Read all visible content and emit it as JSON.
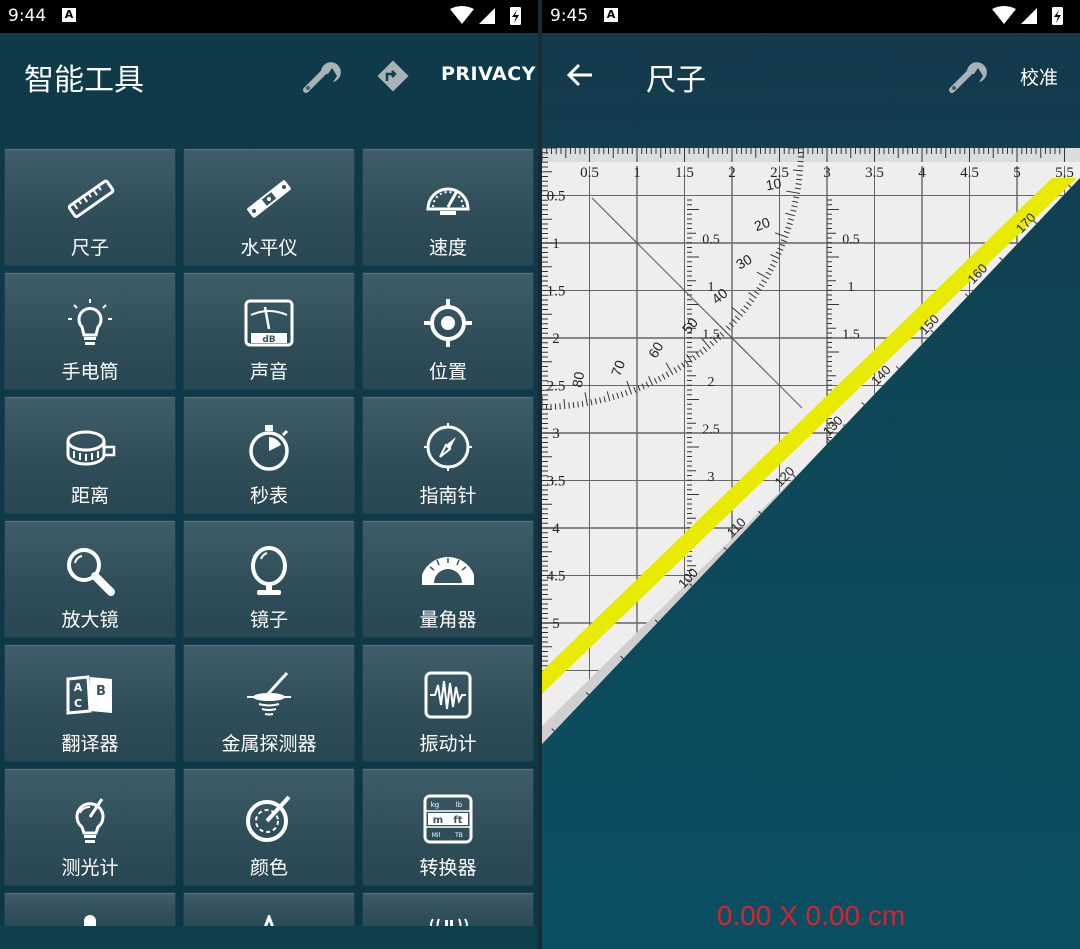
{
  "left": {
    "status_time": "9:44",
    "status_notification": "A",
    "title": "智能工具",
    "privacy_label": "PRIVACY",
    "tools": [
      {
        "label": "尺子",
        "icon": "ruler-icon"
      },
      {
        "label": "水平仪",
        "icon": "level-icon"
      },
      {
        "label": "速度",
        "icon": "speedometer-icon"
      },
      {
        "label": "手电筒",
        "icon": "flashlight-icon"
      },
      {
        "label": "声音",
        "icon": "sound-meter-icon"
      },
      {
        "label": "位置",
        "icon": "location-icon"
      },
      {
        "label": "距离",
        "icon": "tape-measure-icon"
      },
      {
        "label": "秒表",
        "icon": "stopwatch-icon"
      },
      {
        "label": "指南针",
        "icon": "compass-icon"
      },
      {
        "label": "放大镜",
        "icon": "magnifier-icon"
      },
      {
        "label": "镜子",
        "icon": "mirror-icon"
      },
      {
        "label": "量角器",
        "icon": "protractor-icon"
      },
      {
        "label": "翻译器",
        "icon": "translator-icon"
      },
      {
        "label": "金属探测器",
        "icon": "metal-detector-icon"
      },
      {
        "label": "振动计",
        "icon": "vibration-meter-icon"
      },
      {
        "label": "测光计",
        "icon": "light-meter-icon"
      },
      {
        "label": "颜色",
        "icon": "color-picker-icon"
      },
      {
        "label": "转换器",
        "icon": "unit-converter-icon"
      }
    ],
    "sound_icon_label": "dB",
    "converter_icon_labels": [
      "kg",
      "lb",
      "m",
      "ft",
      "Mil",
      "TB"
    ]
  },
  "right": {
    "status_time": "9:45",
    "status_notification": "A",
    "title": "尺子",
    "calibrate_label": "校准",
    "measurement": "0.00 X 0.00 cm",
    "top_scale_labels": [
      "0.5",
      "1",
      "1.5",
      "2",
      "2.5",
      "3",
      "3.5",
      "4",
      "4.5",
      "5",
      "5.5"
    ],
    "left_scale_labels": [
      "0.5",
      "1",
      "1.5",
      "2",
      "2.5",
      "3",
      "3.5",
      "4",
      "4.5",
      "5"
    ],
    "inner_scale_labels": [
      "0.5",
      "1",
      "1.5",
      "2",
      "2.5",
      "3"
    ],
    "arc_labels": [
      "10",
      "20",
      "30",
      "40",
      "50",
      "60",
      "70",
      "80"
    ],
    "hypotenuse_outer_labels": [
      "100",
      "110",
      "120",
      "130",
      "140",
      "150",
      "160",
      "170"
    ],
    "hypotenuse_inner_labels": [
      "80",
      "70",
      "60",
      "50",
      "40",
      "30",
      "20",
      "10"
    ]
  },
  "colors": {
    "background": "#0c3846",
    "tile": "#36545f",
    "highlight": "#e8ea00",
    "measurement": "#d8232a"
  }
}
